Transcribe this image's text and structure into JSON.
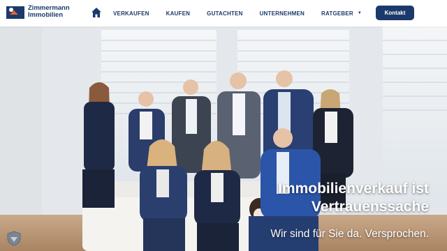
{
  "brand": {
    "line1": "Zimmermann",
    "line2": "Immobilien"
  },
  "nav": {
    "home_icon": "home-icon",
    "items": [
      {
        "label": "VERKAUFEN"
      },
      {
        "label": "KAUFEN"
      },
      {
        "label": "GUTACHTEN"
      },
      {
        "label": "UNTERNEHMEN"
      },
      {
        "label": "RATGEBER"
      }
    ],
    "contact_label": "Kontakt"
  },
  "hero": {
    "headline_line1": "Immobilienverkauf ist",
    "headline_line2": "Vertrauenssache",
    "subline": "Wir sind für Sie da. Versprochen."
  },
  "colors": {
    "brand": "#1b3a6b",
    "accent_orange": "#e8632b",
    "hero_text": "#ffffff"
  }
}
